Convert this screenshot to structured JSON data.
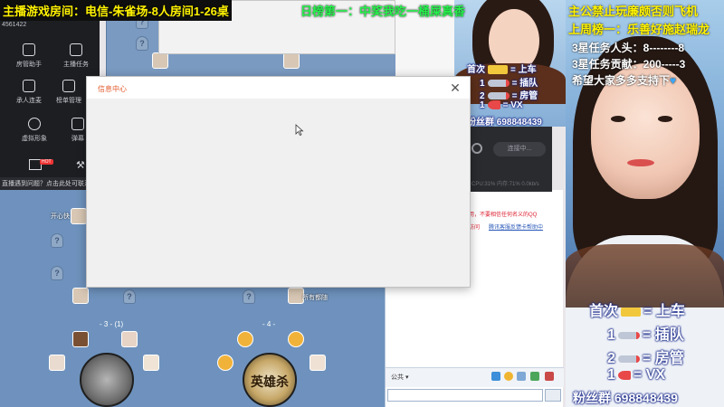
{
  "top_banner": {
    "left": "主播游戏房间：电信-朱雀场-8人房间1-26桌",
    "center": "日榜第一：中奖我吃一桶屎真香"
  },
  "right_overlay": {
    "line1": "主公禁止玩廉颇否则飞机",
    "line2": "上周榜一：乐善好施赵瑞龙",
    "line3": "3星任务人头：8--------8",
    "line4": "3星任务贡献：200-----3",
    "line5": "希望大家多多支持下",
    "heart": "♥"
  },
  "rules_small": {
    "r1_left": "首次",
    "r1_right": "上车",
    "r2_left": "1",
    "r2_right": "插队",
    "r3_left": "2",
    "r3_right": "房管",
    "r4_left": "1",
    "r4_right": "VX",
    "fans": "粉丝群 698848439",
    "eq": "="
  },
  "rules_big": {
    "r1_left": "首次",
    "r1_right": "上车",
    "r2_left": "1",
    "r2_right": "插队",
    "r3_left": "2",
    "r3_right": "房管",
    "r4_left": "1",
    "r4_right": "VX",
    "fans": "粉丝群 698848439",
    "eq": "="
  },
  "left_panel": {
    "user_id": "4561422",
    "items": [
      {
        "label": "房管助手",
        "icon": "shield-icon"
      },
      {
        "label": "主播任务",
        "icon": "task-icon"
      },
      {
        "label": "承人连麦",
        "icon": "download-icon"
      },
      {
        "label": "榜单管理",
        "icon": "list-icon"
      },
      {
        "label": "虚拟形象",
        "icon": "bear-icon"
      },
      {
        "label": "弹幕",
        "icon": "chat-icon"
      }
    ],
    "hot": "HOT",
    "help": "直播遇到问题？点击此处可联系"
  },
  "dialog": {
    "title": "信息中心",
    "close": "✕"
  },
  "dark_panel": {
    "connect": "连接中...",
    "stats": "CPU:31%  内存:71%  0.0kb/s"
  },
  "lobby": {
    "label_happy": "开心快",
    "label_all": "所有都随",
    "table3": "- 3 -   (1)",
    "table4": "- 4 -",
    "seat_q": "?",
    "table_text": "英雄杀"
  },
  "chat": {
    "line1": "用，不要相信任何名义的QQ",
    "line2": "访问",
    "line3_link": "腾讯客服反馈卡帮助中",
    "channel": "公共 ▾"
  },
  "colors": {
    "accent_orange": "#e25b2c",
    "banner_yellow": "#fff200",
    "banner_green": "#24f24a",
    "lobby_blue": "#6e92bd"
  }
}
